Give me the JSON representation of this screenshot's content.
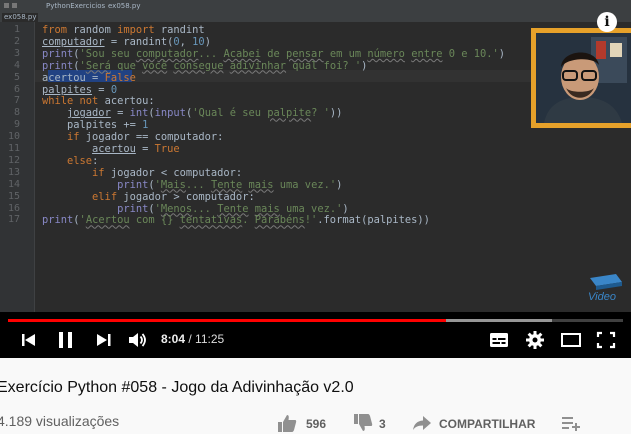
{
  "ide": {
    "tabs": [
      {
        "label": "ex058.py"
      },
      {
        "label": "PythonExercicios"
      },
      {
        "label": "ex058.py"
      }
    ]
  },
  "gutter": [
    "1",
    "2",
    "3",
    "4",
    "5",
    "6",
    "7",
    "8",
    "9",
    "10",
    "11",
    "12",
    "13",
    "14",
    "15",
    "16",
    "17"
  ],
  "code": {
    "l1": {
      "kw1": "from",
      "mod": " random ",
      "kw2": "import",
      "rest": " randint"
    },
    "l2": {
      "var": "computador",
      "mid": " = randint(",
      "n1": "0",
      "sep": ", ",
      "n2": "10",
      "end": ")"
    },
    "l3": {
      "fn": "print",
      "open": "(",
      "q1": "'Sou seu ",
      "w1": "computador",
      "t1": "... ",
      "w2": "Acabei",
      "t2": " de ",
      "w3": "pensar",
      "t3": " em um ",
      "w4": "número",
      "t4": " ",
      "w5": "entre",
      "t5": " 0 e 10.'",
      "close": ")"
    },
    "l4": {
      "fn": "print",
      "open": "(",
      "q1": "'",
      "w1": "Será",
      "t1": " que ",
      "w2": "você",
      "t2": " ",
      "w3": "consegue",
      "t3": " ",
      "w4": "adivinhar",
      "t4": " qual foi? '",
      "close": ")"
    },
    "l5": {
      "var": "acertou",
      "mid": " = ",
      "val": "False"
    },
    "l6": {
      "var": "palpites",
      "mid": " = ",
      "val": "0"
    },
    "l7": {
      "kw": "while not",
      "rest": " acertou:"
    },
    "l8": {
      "indent": "    ",
      "var": "jogador",
      "mid": " = ",
      "b1": "int",
      "p1": "(",
      "b2": "input",
      "p2": "(",
      "q1": "'Qual é seu ",
      "w1": "palpite",
      "q2": "? '",
      "close": "))"
    },
    "l9": {
      "indent": "    ",
      "rest": "palpites += ",
      "val": "1"
    },
    "l10": {
      "indent": "    ",
      "kw": "if",
      "rest": " jogador == computador:"
    },
    "l11": {
      "indent": "        ",
      "var": "acertou",
      "mid": " = ",
      "val": "True"
    },
    "l12": {
      "indent": "    ",
      "kw": "else",
      "rest": ":"
    },
    "l13": {
      "indent": "        ",
      "kw": "if",
      "rest": " jogador < computador:"
    },
    "l14": {
      "indent": "            ",
      "fn": "print",
      "open": "(",
      "q1": "'",
      "w1": "Mais",
      "t1": "... ",
      "w2": "Tente",
      "t2": " ",
      "w3": "mais",
      "t3": " uma vez.'",
      "close": ")"
    },
    "l15": {
      "indent": "        ",
      "kw": "elif",
      "rest": " jogador > computador:"
    },
    "l16": {
      "indent": "            ",
      "fn": "print",
      "open": "(",
      "q1": "'",
      "w1": "Menos",
      "t1": "... ",
      "w2": "Tente",
      "t2": " ",
      "w3": "mais",
      "t3": " uma vez.'",
      "close": ")"
    },
    "l17": {
      "fn": "print",
      "open": "(",
      "q1": "'",
      "w1": "Acertou",
      "t1": " com {} ",
      "w2": "tentativas",
      "t2": ". ",
      "w3": "Parabéns",
      "t3": "!'",
      "rest": ".format(palpites)",
      "close": ")"
    }
  },
  "player": {
    "info_icon": "info-icon",
    "watermark_label": "Video",
    "progress": {
      "played": 0.712,
      "buffered": 0.885
    },
    "time_current": "8:04",
    "time_separator": " / ",
    "time_duration": "11:25",
    "icons": [
      "skip-previous-icon",
      "pause-icon",
      "skip-next-icon",
      "volume-icon",
      "subtitles-icon",
      "settings-gear-icon",
      "theater-mode-icon",
      "fullscreen-icon"
    ]
  },
  "video": {
    "title": "Exercício Python #058 - Jogo da Adivinhação v2.0",
    "views": "4.189 visualizações",
    "likes": "596",
    "dislikes": "3",
    "share_label": "COMPARTILHAR"
  },
  "colors": {
    "progress": "#ff0000",
    "keyword": "#cc7832",
    "string": "#6a8759",
    "number": "#6897bb",
    "webcam_border": "#e6a12a"
  }
}
